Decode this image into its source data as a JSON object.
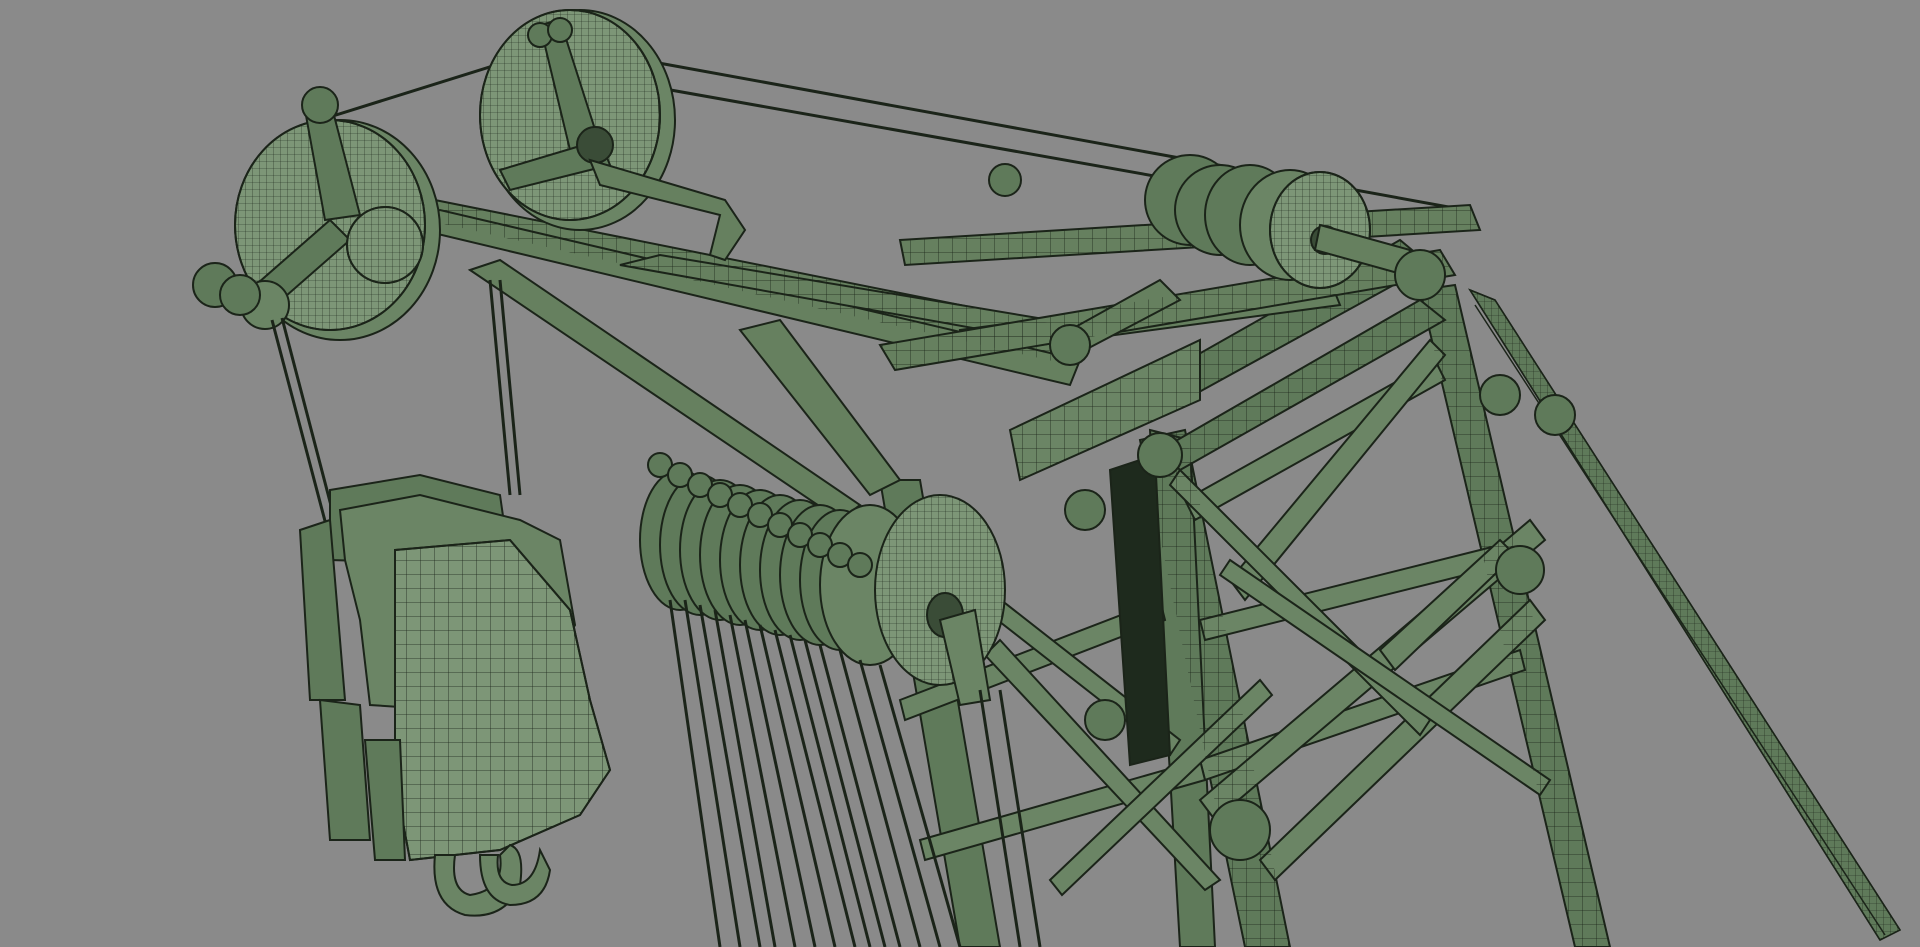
{
  "scene": {
    "background_color": "#8a8a8a",
    "mesh_fill_color": "#5f7a5a",
    "mesh_fill_light": "#7d9677",
    "mesh_dark_color": "#1e2a1d",
    "wire_color": "#1b2419",
    "render_mode": "wireframe-on-shaded"
  },
  "objects": [
    {
      "name": "boom-lattice",
      "icon": "lattice-truss"
    },
    {
      "name": "boom-tip-sheaves",
      "icon": "pulley-wheel"
    },
    {
      "name": "main-sheave-block",
      "icon": "pulley-stack"
    },
    {
      "name": "hook-block",
      "icon": "crane-hook"
    },
    {
      "name": "hoist-ropes",
      "icon": "cable"
    },
    {
      "name": "pendant-lines",
      "icon": "cable"
    }
  ]
}
